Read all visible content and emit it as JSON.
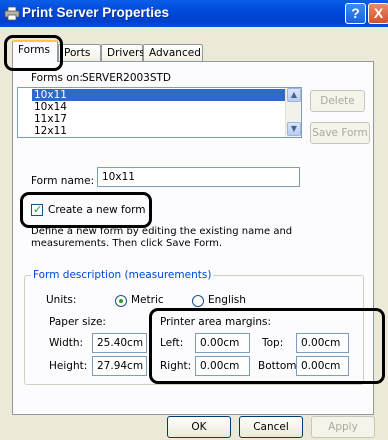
{
  "window": {
    "title": "Print Server Properties",
    "help_glyph": "?",
    "close_glyph": "X"
  },
  "tabs": [
    {
      "label": "Forms"
    },
    {
      "label": "Ports"
    },
    {
      "label": "Drivers"
    },
    {
      "label": "Advanced"
    }
  ],
  "forms_on": {
    "label": "Forms on:",
    "server": "SERVER2003STD"
  },
  "form_list": {
    "items": [
      "10x11",
      "10x14",
      "11x17",
      "12x11"
    ],
    "selected": "10x11"
  },
  "buttons": {
    "delete": "Delete",
    "save_form": "Save Form",
    "ok": "OK",
    "cancel": "Cancel",
    "apply": "Apply"
  },
  "form_name": {
    "label": "Form name:",
    "value": "10x11"
  },
  "create_new_form": {
    "label": "Create a new form",
    "checked": true
  },
  "description": "Define a new form by editing the existing name and measurements. Then click Save Form.",
  "form_description_group": {
    "title": "Form description (measurements)",
    "units_label": "Units:",
    "metric_label": "Metric",
    "english_label": "English",
    "selected_unit": "Metric",
    "paper_size_label": "Paper size:",
    "width_label": "Width:",
    "width_value": "25.40cm",
    "height_label": "Height:",
    "height_value": "27.94cm",
    "margins_label": "Printer area margins:",
    "left_label": "Left:",
    "left_value": "0.00cm",
    "right_label": "Right:",
    "right_value": "0.00cm",
    "top_label": "Top:",
    "top_value": "0.00cm",
    "bottom_label": "Bottom:",
    "bottom_value": "0.00cm"
  },
  "colors": {
    "titlebar": "#0048d8",
    "selection": "#316ac5",
    "group_title": "#0046d5",
    "check": "#21a121"
  }
}
